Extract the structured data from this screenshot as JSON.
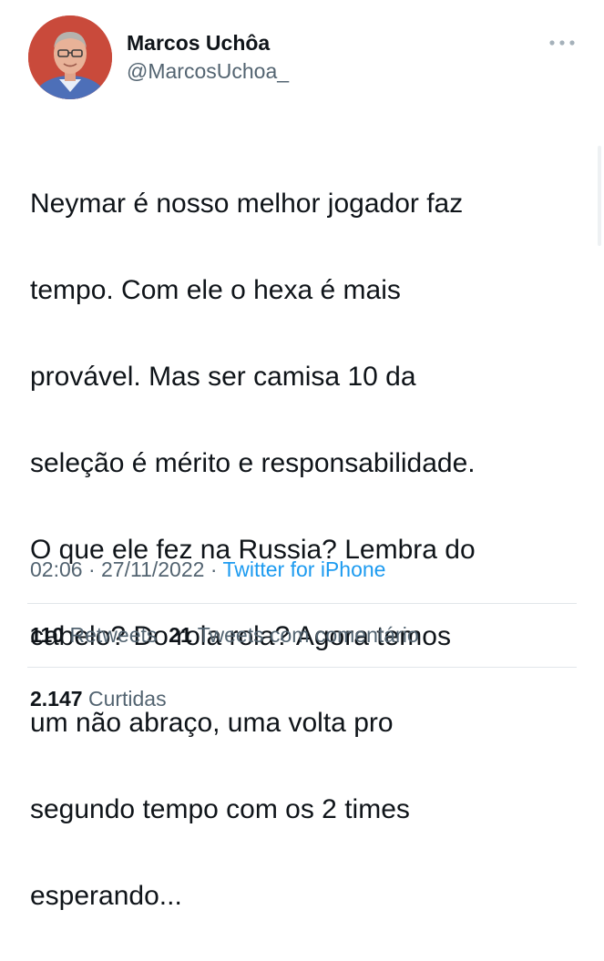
{
  "author": {
    "display_name": "Marcos Uchôa",
    "handle": "@MarcosUchoa_"
  },
  "tweet": {
    "lines": [
      "Neymar é nosso melhor jogador faz",
      "tempo. Com ele o hexa é mais",
      "provável. Mas ser camisa 10 da",
      "seleção é mérito e responsabilidade.",
      "O que ele fez na Russia? Lembra do",
      "cabelo? Do rola rola? Agora temos",
      "um não abraço, uma volta pro",
      "segundo tempo com os 2 times",
      "esperando..."
    ]
  },
  "meta": {
    "time": "02:06",
    "separator": "·",
    "date": "27/11/2022",
    "source": "Twitter for iPhone"
  },
  "stats": {
    "retweets_count": "110",
    "retweets_label": "Retweets",
    "quote_count": "21",
    "quote_label": "Tweets com comentário",
    "likes_count": "2.147",
    "likes_label": "Curtidas"
  },
  "icons": {
    "more": "more-horizontal-icon"
  },
  "colors": {
    "text": "#0f1419",
    "secondary": "#536471",
    "link": "#1d9bf0",
    "divider": "#e1e6ea"
  }
}
